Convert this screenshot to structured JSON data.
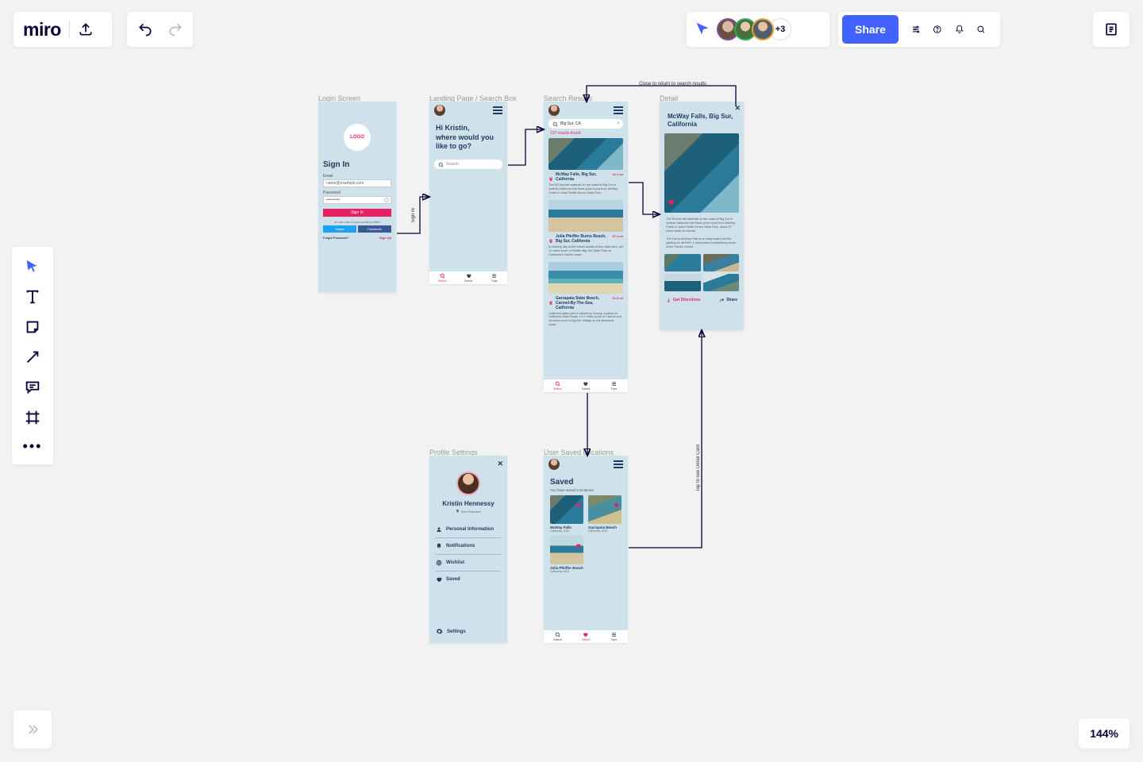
{
  "app": {
    "name": "miro"
  },
  "collaborators": {
    "overflow": "+3"
  },
  "share": {
    "label": "Share"
  },
  "zoom": {
    "level": "144%"
  },
  "frames": {
    "login": {
      "label": "Login Screen",
      "logo": "LOGO",
      "heading": "Sign In",
      "email_label": "Email",
      "email_value": "name@example.com",
      "password_label": "Password",
      "password_value": "••••••••••",
      "signin_btn": "Sign In",
      "social_hint": "or use one of your social profiles",
      "twitter": "Twitter",
      "facebook": "Facebook",
      "forgot": "Forgot Password?",
      "signup": "Sign Up"
    },
    "landing": {
      "label": "Landing Page / Search Box",
      "greeting": "Hi Kristin,\nwhere would you like to go?",
      "search_placeholder": "Search",
      "tabs": {
        "search": "Search",
        "saved": "Saved",
        "trips": "Trips"
      }
    },
    "search_results": {
      "label": "Search Results",
      "query": "Big Sur, CA",
      "count": "137 results found",
      "tabs": {
        "search": "Search",
        "saved": "Saved",
        "trips": "Trips"
      },
      "items": [
        {
          "title": "McWay Falls, Big Sur, California",
          "distance": "42.1 mi",
          "desc": "This 80-foot-tall waterfall on the coast of Big Sur in central California that flows year-round from McWay Creek in Julia Pfeiffer Burns State Park…"
        },
        {
          "title": "Julia Pfeiffer Burns Beach, Big Sur, California",
          "distance": "57.4 mi",
          "desc": "A relaxing day at the beach awaits at this state park, set 12 miles south of Pfeiffer Big Sur State Park on California's Pacific coast…"
        },
        {
          "title": "Garrapata State Beach, Carmel-By-The-Sea, California",
          "distance": "41.5 mi",
          "desc": "California state park in Monterey County, located on California State Route 1 6.7 miles south of Carmel and 18 miles north of Big Sur Village on the Monterey coast…"
        }
      ]
    },
    "detail": {
      "label": "Detail",
      "title": "McWay Falls, Big Sur, California",
      "para1": "The 80-foot tall waterfall on the coast of Big Sur in central California that flows year-round from McWay Creek in Julia Pfeiffer Burns State Park, about 37 miles south of Carmel.",
      "para2": "The trail to McWay Falls is an easy walk from the parking lot off HWY 1 and boasts breathtaking views of the Pacific Ocean.",
      "get_directions": "Get Directions",
      "share": "Share"
    },
    "profile": {
      "label": "Profile Settings",
      "name": "Kristin Hennessy",
      "location": "San Francisco",
      "menu": {
        "personal": "Personal Information",
        "notifications": "Notifications",
        "wishlist": "Wishlist",
        "saved": "Saved"
      },
      "settings": "Settings"
    },
    "saved": {
      "label": "User Saved Locations",
      "heading": "Saved",
      "subheading": "You have saved 3 locations",
      "tabs": {
        "search": "Search",
        "saved": "Saved",
        "trips": "Trips"
      },
      "items": [
        {
          "title": "McWay Falls",
          "sub": "California, USA"
        },
        {
          "title": "Garrapata Beach",
          "sub": "California, USA"
        },
        {
          "title": "Julia Pfeiffer Beach",
          "sub": "California, USA"
        }
      ]
    }
  },
  "annotations": {
    "signin": "Sign In",
    "close_return": "Close to return to search results",
    "tap_detail": "Tap to see Detail Card"
  }
}
